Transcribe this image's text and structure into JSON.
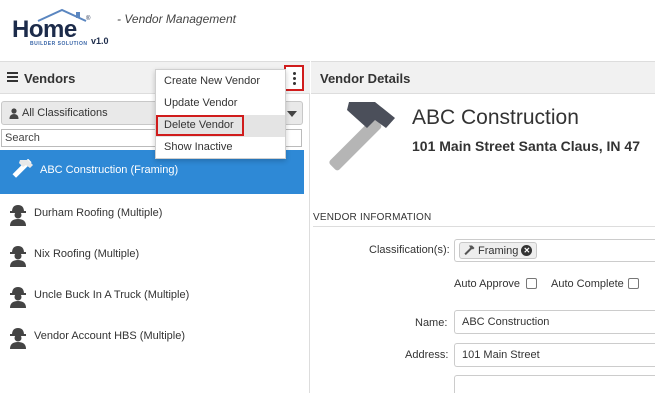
{
  "app": {
    "logo_text": "Home",
    "logo_sub": "BUILDER SOLUTION",
    "logo_registered": "®",
    "version": "v1.0",
    "subtitle": "- Vendor Management"
  },
  "left_panel": {
    "title": "Vendors",
    "classification_selected": "All Classifications",
    "search_placeholder": "Search",
    "vendors": [
      {
        "label": "ABC Construction (Framing)",
        "icon": "hammer-icon",
        "selected": true
      },
      {
        "label": "Durham Roofing (Multiple)",
        "icon": "worker-icon",
        "selected": false
      },
      {
        "label": "Nix Roofing (Multiple)",
        "icon": "worker-icon",
        "selected": false
      },
      {
        "label": "Uncle Buck In A Truck (Multiple)",
        "icon": "worker-icon",
        "selected": false
      },
      {
        "label": "Vendor Account HBS (Multiple)",
        "icon": "worker-icon",
        "selected": false
      }
    ]
  },
  "menu": {
    "items": [
      {
        "label": "Create New Vendor"
      },
      {
        "label": "Update Vendor"
      },
      {
        "label": "Delete Vendor"
      },
      {
        "label": "Show Inactive"
      }
    ]
  },
  "right_panel": {
    "title": "Vendor Details",
    "vendor_name": "ABC Construction",
    "vendor_address": "101 Main Street Santa Claus, IN 47",
    "section_label": "VENDOR INFORMATION",
    "classification_label": "Classification(s):",
    "classification_chip": "Framing",
    "auto_approve_label": "Auto Approve",
    "auto_complete_label": "Auto Complete",
    "name_label": "Name:",
    "name_value": "ABC Construction",
    "address_label": "Address:",
    "address_value": "101 Main Street",
    "address2_value": ""
  },
  "colors": {
    "selected_row": "#2e89d6",
    "highlight_border": "#d01c1c",
    "icon_gray": "#4b4f5a"
  }
}
